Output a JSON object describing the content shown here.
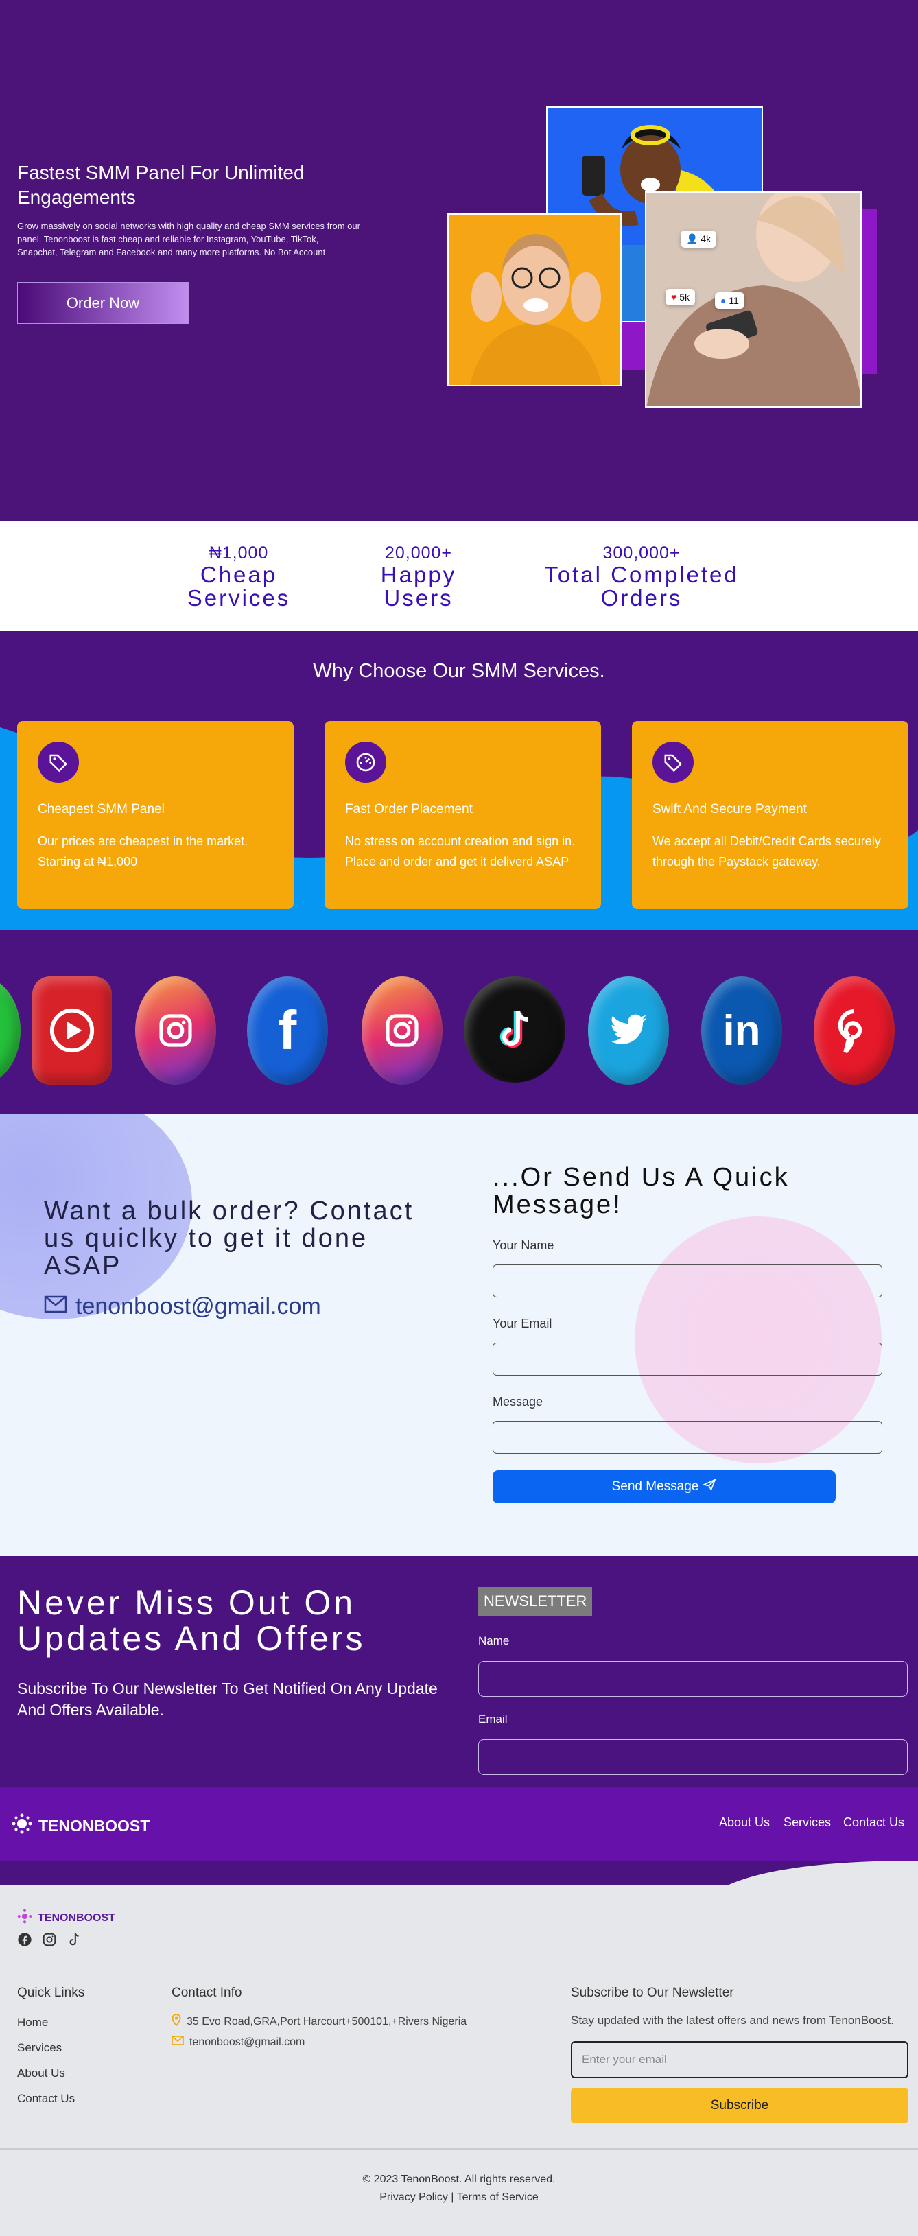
{
  "hero": {
    "title": "Fastest SMM Panel For Unlimited Engagements",
    "description": "Grow massively on social networks with high quality and cheap SMM services from our panel. Tenonboost is fast cheap and reliable for Instagram, YouTube, TikTok, Snapchat, Telegram and Facebook and many more platforms. No Bot Account",
    "order_button": "Order Now",
    "photo_tags": {
      "followers": "4k",
      "likes": "5k",
      "comments": "11"
    }
  },
  "stats": [
    {
      "number": "₦1,000",
      "label": "Cheap Services"
    },
    {
      "number": "20,000+",
      "label": "Happy Users"
    },
    {
      "number": "300,000+",
      "label": "Total Completed Orders"
    }
  ],
  "why": {
    "title": "Why Choose Our SMM Services.",
    "cards": [
      {
        "icon": "tag-icon",
        "title": "Cheapest SMM Panel",
        "desc": "Our prices are cheapest in the market. Starting at ₦1,000"
      },
      {
        "icon": "speedometer-icon",
        "title": "Fast Order Placement",
        "desc": "No stress on account creation and sign in. Place and order and get it deliverd ASAP"
      },
      {
        "icon": "tag-icon",
        "title": "Swift And Secure Payment",
        "desc": "We accept all Debit/Credit Cards securely through the Paystack gateway."
      }
    ]
  },
  "social_icons": [
    "whatsapp-icon",
    "youtube-icon",
    "instagram-icon",
    "facebook-icon",
    "instagram-icon",
    "tiktok-icon",
    "twitter-icon",
    "linkedin-icon",
    "pinterest-icon"
  ],
  "contact": {
    "bulk_title": "Want a bulk order? Contact us quiclky to get it done ASAP",
    "email": "tenonboost@gmail.com",
    "quick_title": "...Or Send Us A Quick Message!",
    "name_label": "Your Name",
    "email_label": "Your Email",
    "message_label": "Message",
    "send_button": "Send Message"
  },
  "newsletter": {
    "title": "Never Miss Out On Updates And Offers",
    "subtitle": "Subscribe To Our Newsletter To Get Notified On Any Update And Offers Available.",
    "badge": "NEWSLETTER",
    "name_label": "Name",
    "email_label": "Email"
  },
  "nav": {
    "brand": "TENONBOOST",
    "links": [
      "About Us",
      "Services",
      "Contact Us"
    ]
  },
  "footer": {
    "brand": "TENONBOOST",
    "quick_links_title": "Quick Links",
    "quick_links": [
      "Home",
      "Services",
      "About Us",
      "Contact Us"
    ],
    "contact_title": "Contact Info",
    "address": "35 Evo Road,GRA,Port Harcourt+500101,+Rivers Nigeria",
    "email": "tenonboost@gmail.com",
    "subscribe_title": "Subscribe to Our Newsletter",
    "subscribe_desc": "Stay updated with the latest offers and news from TenonBoost.",
    "email_placeholder": "Enter your email",
    "subscribe_button": "Subscribe",
    "copyright": "© 2023 TenonBoost. All rights reserved.",
    "privacy": "Privacy Policy",
    "separator": "|",
    "terms": "Terms of Service"
  },
  "colors": {
    "purple": "#4b1380",
    "nav_purple": "#6611a9",
    "orange": "#f6a80a",
    "blue": "#0a66f2",
    "yellow": "#f8bc24"
  }
}
